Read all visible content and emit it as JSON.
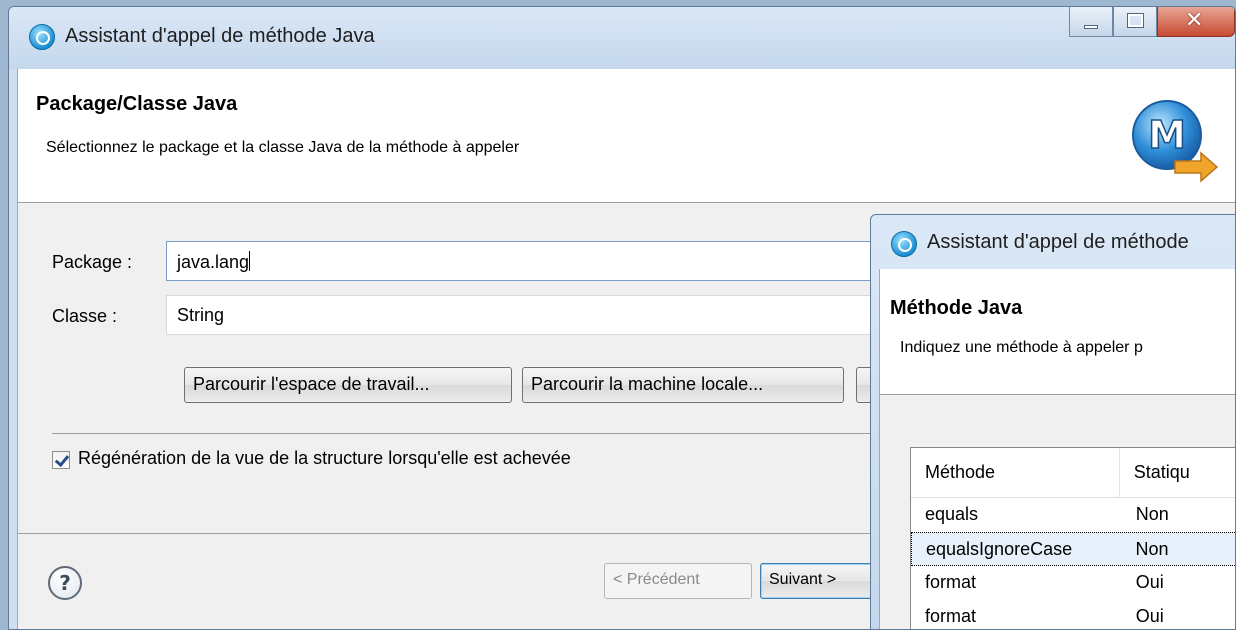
{
  "main_window": {
    "title": "Assistant d'appel de méthode Java",
    "banner": {
      "title": "Package/Classe Java",
      "description": "Sélectionnez le package et la classe Java de la méthode à appeler"
    },
    "package_label": "Package :",
    "package_value": "java.lang",
    "class_label": "Classe :",
    "class_value": "String",
    "browse_workspace_label": "Parcourir l'espace de travail...",
    "browse_local_label": "Parcourir la machine locale...",
    "checkbox_label": "Régénération de la vue de la structure lorsqu'elle est achevée",
    "checkbox_checked": true,
    "help_glyph": "?",
    "previous_label": "< Précédent",
    "next_label": "Suivant >"
  },
  "method_window": {
    "title": "Assistant d'appel de méthode",
    "banner": {
      "title": "Méthode Java",
      "description": "Indiquez une méthode à appeler p"
    },
    "table": {
      "columns": [
        "Méthode",
        "Statiqu"
      ],
      "rows": [
        {
          "method": "equals",
          "static": "Non"
        },
        {
          "method": "equalsIgnoreCase",
          "static": "Non"
        },
        {
          "method": "format",
          "static": "Oui"
        },
        {
          "method": "format",
          "static": "Oui"
        }
      ],
      "selected_row": 1
    }
  },
  "colors": {
    "title_bar": "#c4d7ec",
    "close_button": "#c84a33",
    "focus_border": "#7a9cc9"
  },
  "icons": [
    "app-icon",
    "minimize-icon",
    "maximize-icon",
    "close-icon",
    "wizard-method-icon",
    "help-icon",
    "checkbox-check-icon"
  ]
}
